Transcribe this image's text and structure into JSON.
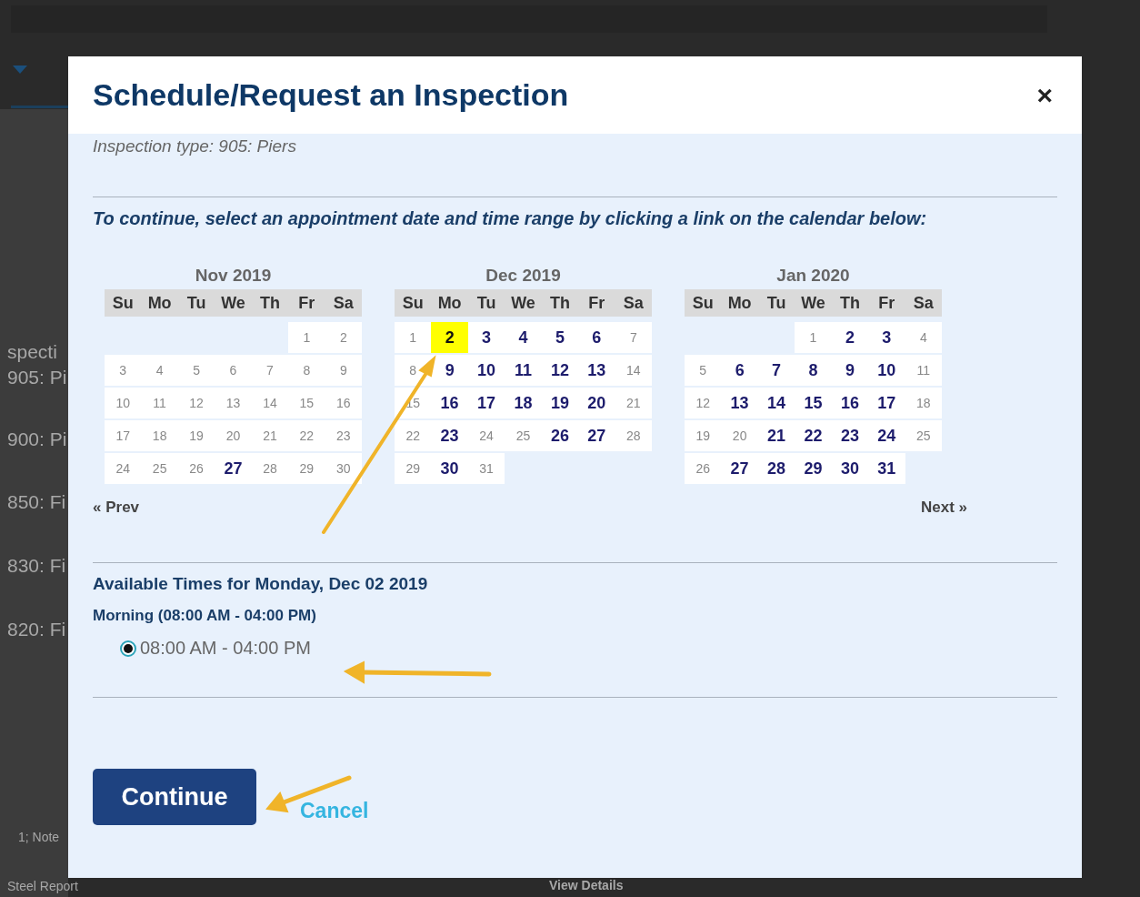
{
  "background_page": {
    "texts": [
      "specti",
      "905: Pi",
      "900: Pi",
      "850: Fi",
      "830: Fi",
      "820: Fi",
      "1; Note",
      "Steel Report",
      "View Details"
    ]
  },
  "dialog": {
    "title": "Schedule/Request an Inspection",
    "close": "×",
    "inspection_type": "Inspection type: 905: Piers",
    "instruction": "To continue, select an appointment date and time range by clicking a link on the calendar below:",
    "months": [
      {
        "title": "Nov 2019",
        "weekdays": [
          "Su",
          "Mo",
          "Tu",
          "We",
          "Th",
          "Fr",
          "Sa"
        ],
        "weeks": [
          [
            {
              "kind": "blank"
            },
            {
              "kind": "blank"
            },
            {
              "kind": "blank"
            },
            {
              "kind": "blank"
            },
            {
              "kind": "blank"
            },
            {
              "kind": "day",
              "day": "1",
              "available": false,
              "selected": false
            },
            {
              "kind": "day",
              "day": "2",
              "available": false,
              "selected": false
            }
          ],
          [
            {
              "kind": "day",
              "day": "3",
              "available": false,
              "selected": false
            },
            {
              "kind": "day",
              "day": "4",
              "available": false,
              "selected": false
            },
            {
              "kind": "day",
              "day": "5",
              "available": false,
              "selected": false
            },
            {
              "kind": "day",
              "day": "6",
              "available": false,
              "selected": false
            },
            {
              "kind": "day",
              "day": "7",
              "available": false,
              "selected": false
            },
            {
              "kind": "day",
              "day": "8",
              "available": false,
              "selected": false
            },
            {
              "kind": "day",
              "day": "9",
              "available": false,
              "selected": false
            }
          ],
          [
            {
              "kind": "day",
              "day": "10",
              "available": false,
              "selected": false
            },
            {
              "kind": "day",
              "day": "11",
              "available": false,
              "selected": false
            },
            {
              "kind": "day",
              "day": "12",
              "available": false,
              "selected": false
            },
            {
              "kind": "day",
              "day": "13",
              "available": false,
              "selected": false
            },
            {
              "kind": "day",
              "day": "14",
              "available": false,
              "selected": false
            },
            {
              "kind": "day",
              "day": "15",
              "available": false,
              "selected": false
            },
            {
              "kind": "day",
              "day": "16",
              "available": false,
              "selected": false
            }
          ],
          [
            {
              "kind": "day",
              "day": "17",
              "available": false,
              "selected": false
            },
            {
              "kind": "day",
              "day": "18",
              "available": false,
              "selected": false
            },
            {
              "kind": "day",
              "day": "19",
              "available": false,
              "selected": false
            },
            {
              "kind": "day",
              "day": "20",
              "available": false,
              "selected": false
            },
            {
              "kind": "day",
              "day": "21",
              "available": false,
              "selected": false
            },
            {
              "kind": "day",
              "day": "22",
              "available": false,
              "selected": false
            },
            {
              "kind": "day",
              "day": "23",
              "available": false,
              "selected": false
            }
          ],
          [
            {
              "kind": "day",
              "day": "24",
              "available": false,
              "selected": false
            },
            {
              "kind": "day",
              "day": "25",
              "available": false,
              "selected": false
            },
            {
              "kind": "day",
              "day": "26",
              "available": false,
              "selected": false
            },
            {
              "kind": "day",
              "day": "27",
              "available": true,
              "selected": false
            },
            {
              "kind": "day",
              "day": "28",
              "available": false,
              "selected": false
            },
            {
              "kind": "day",
              "day": "29",
              "available": false,
              "selected": false
            },
            {
              "kind": "day",
              "day": "30",
              "available": false,
              "selected": false
            }
          ]
        ]
      },
      {
        "title": "Dec 2019",
        "weekdays": [
          "Su",
          "Mo",
          "Tu",
          "We",
          "Th",
          "Fr",
          "Sa"
        ],
        "weeks": [
          [
            {
              "kind": "day",
              "day": "1",
              "available": false,
              "selected": false
            },
            {
              "kind": "day",
              "day": "2",
              "available": true,
              "selected": true
            },
            {
              "kind": "day",
              "day": "3",
              "available": true,
              "selected": false
            },
            {
              "kind": "day",
              "day": "4",
              "available": true,
              "selected": false
            },
            {
              "kind": "day",
              "day": "5",
              "available": true,
              "selected": false
            },
            {
              "kind": "day",
              "day": "6",
              "available": true,
              "selected": false
            },
            {
              "kind": "day",
              "day": "7",
              "available": false,
              "selected": false
            }
          ],
          [
            {
              "kind": "day",
              "day": "8",
              "available": false,
              "selected": false
            },
            {
              "kind": "day",
              "day": "9",
              "available": true,
              "selected": false
            },
            {
              "kind": "day",
              "day": "10",
              "available": true,
              "selected": false
            },
            {
              "kind": "day",
              "day": "11",
              "available": true,
              "selected": false
            },
            {
              "kind": "day",
              "day": "12",
              "available": true,
              "selected": false
            },
            {
              "kind": "day",
              "day": "13",
              "available": true,
              "selected": false
            },
            {
              "kind": "day",
              "day": "14",
              "available": false,
              "selected": false
            }
          ],
          [
            {
              "kind": "day",
              "day": "15",
              "available": false,
              "selected": false
            },
            {
              "kind": "day",
              "day": "16",
              "available": true,
              "selected": false
            },
            {
              "kind": "day",
              "day": "17",
              "available": true,
              "selected": false
            },
            {
              "kind": "day",
              "day": "18",
              "available": true,
              "selected": false
            },
            {
              "kind": "day",
              "day": "19",
              "available": true,
              "selected": false
            },
            {
              "kind": "day",
              "day": "20",
              "available": true,
              "selected": false
            },
            {
              "kind": "day",
              "day": "21",
              "available": false,
              "selected": false
            }
          ],
          [
            {
              "kind": "day",
              "day": "22",
              "available": false,
              "selected": false
            },
            {
              "kind": "day",
              "day": "23",
              "available": true,
              "selected": false
            },
            {
              "kind": "day",
              "day": "24",
              "available": false,
              "selected": false
            },
            {
              "kind": "day",
              "day": "25",
              "available": false,
              "selected": false
            },
            {
              "kind": "day",
              "day": "26",
              "available": true,
              "selected": false
            },
            {
              "kind": "day",
              "day": "27",
              "available": true,
              "selected": false
            },
            {
              "kind": "day",
              "day": "28",
              "available": false,
              "selected": false
            }
          ],
          [
            {
              "kind": "day",
              "day": "29",
              "available": false,
              "selected": false
            },
            {
              "kind": "day",
              "day": "30",
              "available": true,
              "selected": false
            },
            {
              "kind": "day",
              "day": "31",
              "available": false,
              "selected": false
            },
            {
              "kind": "blank"
            },
            {
              "kind": "blank"
            },
            {
              "kind": "blank"
            },
            {
              "kind": "blank"
            }
          ]
        ]
      },
      {
        "title": "Jan 2020",
        "weekdays": [
          "Su",
          "Mo",
          "Tu",
          "We",
          "Th",
          "Fr",
          "Sa"
        ],
        "weeks": [
          [
            {
              "kind": "blank"
            },
            {
              "kind": "blank"
            },
            {
              "kind": "blank"
            },
            {
              "kind": "day",
              "day": "1",
              "available": false,
              "selected": false
            },
            {
              "kind": "day",
              "day": "2",
              "available": true,
              "selected": false
            },
            {
              "kind": "day",
              "day": "3",
              "available": true,
              "selected": false
            },
            {
              "kind": "day",
              "day": "4",
              "available": false,
              "selected": false
            }
          ],
          [
            {
              "kind": "day",
              "day": "5",
              "available": false,
              "selected": false
            },
            {
              "kind": "day",
              "day": "6",
              "available": true,
              "selected": false
            },
            {
              "kind": "day",
              "day": "7",
              "available": true,
              "selected": false
            },
            {
              "kind": "day",
              "day": "8",
              "available": true,
              "selected": false
            },
            {
              "kind": "day",
              "day": "9",
              "available": true,
              "selected": false
            },
            {
              "kind": "day",
              "day": "10",
              "available": true,
              "selected": false
            },
            {
              "kind": "day",
              "day": "11",
              "available": false,
              "selected": false
            }
          ],
          [
            {
              "kind": "day",
              "day": "12",
              "available": false,
              "selected": false
            },
            {
              "kind": "day",
              "day": "13",
              "available": true,
              "selected": false
            },
            {
              "kind": "day",
              "day": "14",
              "available": true,
              "selected": false
            },
            {
              "kind": "day",
              "day": "15",
              "available": true,
              "selected": false
            },
            {
              "kind": "day",
              "day": "16",
              "available": true,
              "selected": false
            },
            {
              "kind": "day",
              "day": "17",
              "available": true,
              "selected": false
            },
            {
              "kind": "day",
              "day": "18",
              "available": false,
              "selected": false
            }
          ],
          [
            {
              "kind": "day",
              "day": "19",
              "available": false,
              "selected": false
            },
            {
              "kind": "day",
              "day": "20",
              "available": false,
              "selected": false
            },
            {
              "kind": "day",
              "day": "21",
              "available": true,
              "selected": false
            },
            {
              "kind": "day",
              "day": "22",
              "available": true,
              "selected": false
            },
            {
              "kind": "day",
              "day": "23",
              "available": true,
              "selected": false
            },
            {
              "kind": "day",
              "day": "24",
              "available": true,
              "selected": false
            },
            {
              "kind": "day",
              "day": "25",
              "available": false,
              "selected": false
            }
          ],
          [
            {
              "kind": "day",
              "day": "26",
              "available": false,
              "selected": false
            },
            {
              "kind": "day",
              "day": "27",
              "available": true,
              "selected": false
            },
            {
              "kind": "day",
              "day": "28",
              "available": true,
              "selected": false
            },
            {
              "kind": "day",
              "day": "29",
              "available": true,
              "selected": false
            },
            {
              "kind": "day",
              "day": "30",
              "available": true,
              "selected": false
            },
            {
              "kind": "day",
              "day": "31",
              "available": true,
              "selected": false
            },
            {
              "kind": "blank"
            }
          ]
        ]
      }
    ],
    "prev": "« Prev",
    "next": "Next »",
    "times_heading": "Available Times for Monday, Dec 02 2019",
    "slot_group": "Morning (08:00 AM - 04:00 PM)",
    "slots": [
      {
        "label": "08:00 AM - 04:00 PM",
        "selected": true
      }
    ],
    "continue": "Continue",
    "cancel": "Cancel"
  }
}
